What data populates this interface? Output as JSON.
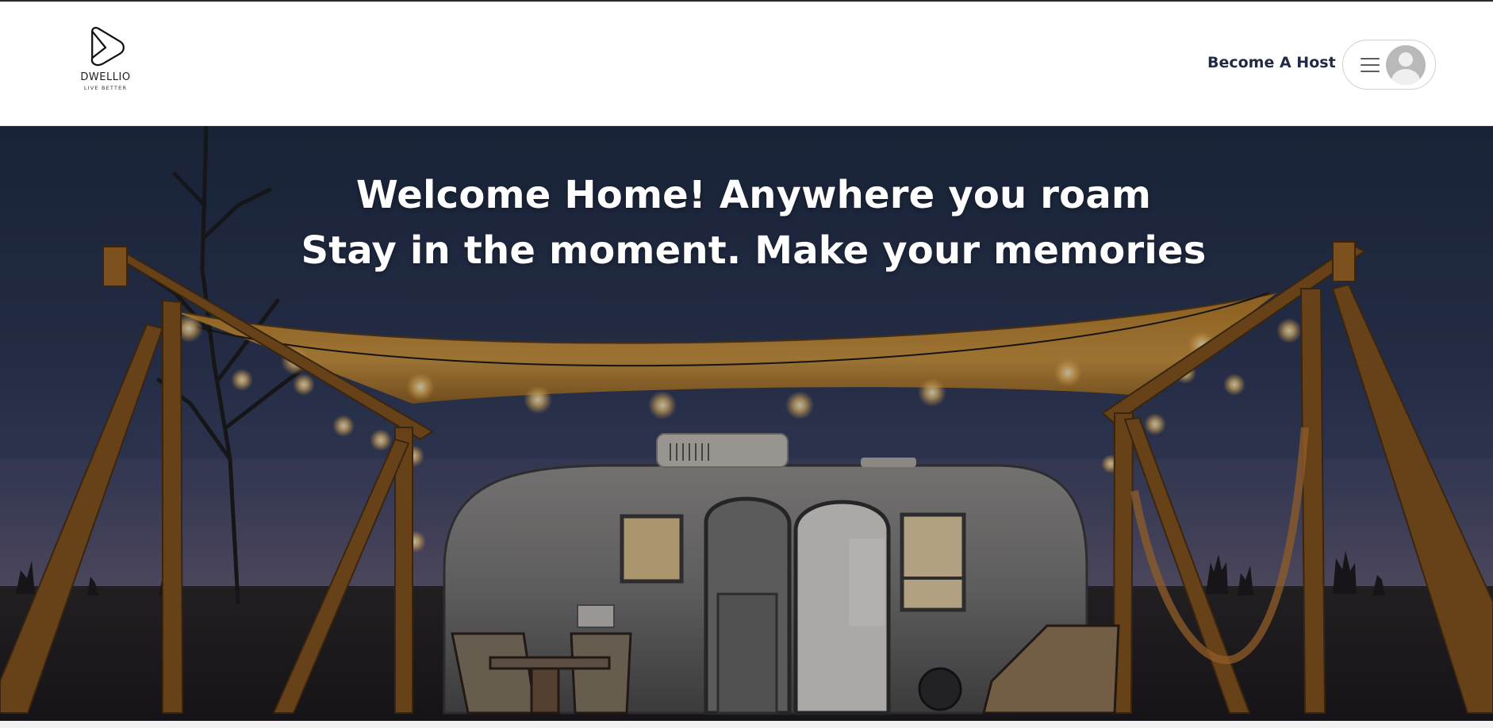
{
  "brand": {
    "name": "DWELLIO",
    "tagline": "LIVE BETTER",
    "icon": "play-triangle-logo"
  },
  "nav": {
    "become_host_label": "Become A Host",
    "menu_icon": "hamburger-icon",
    "avatar_icon": "user-avatar-icon"
  },
  "hero": {
    "line1": "Welcome Home! Anywhere you roam",
    "line2": "Stay in the moment. Make your memories",
    "image": "airstream-trailer-under-string-lights-at-dusk"
  },
  "colors": {
    "nav_text": "#1f2a44",
    "hero_text": "#ffffff",
    "sky": "#1d2a40",
    "canopy": "#d9951e"
  }
}
